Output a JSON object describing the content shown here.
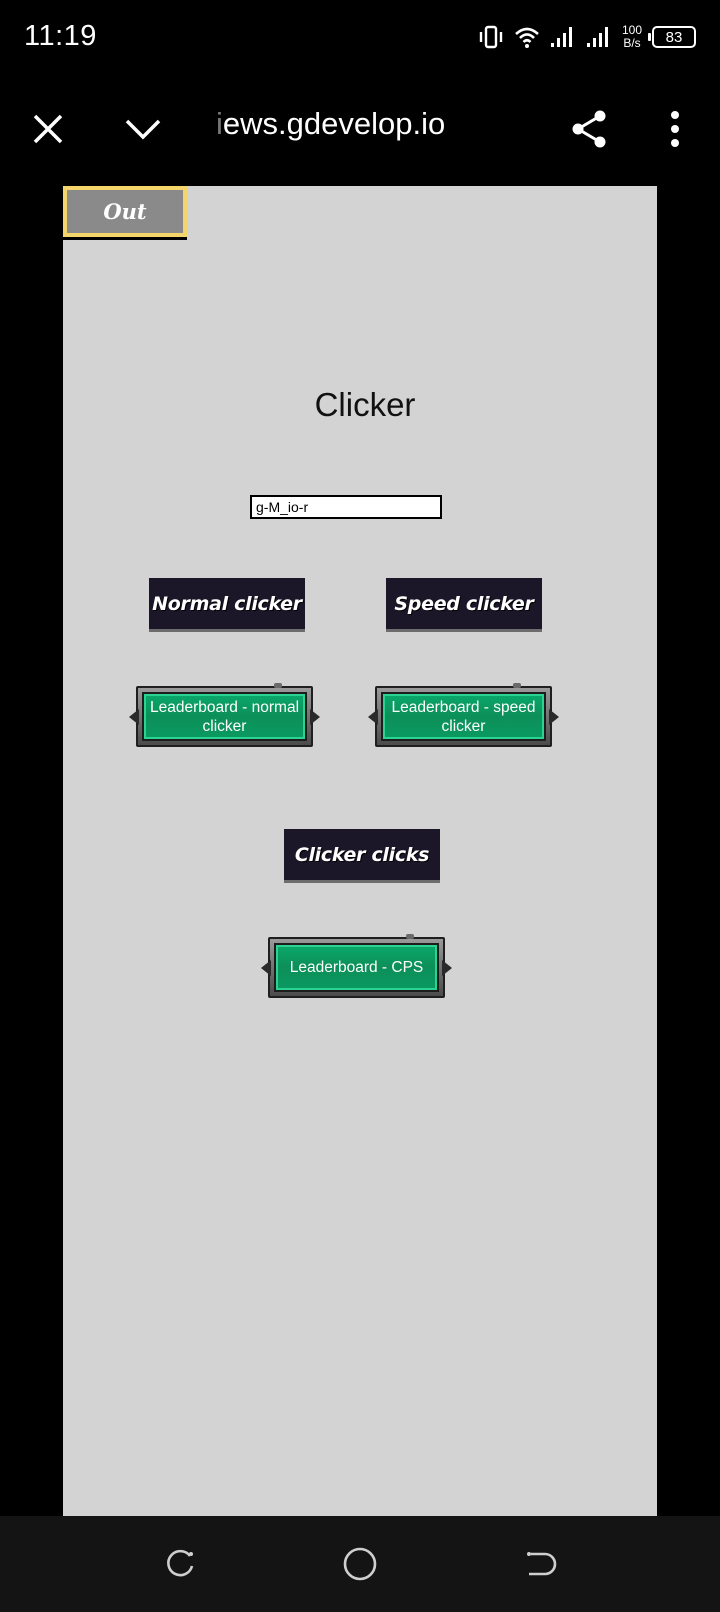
{
  "status_bar": {
    "time": "11:19",
    "net_speed_value": "100",
    "net_speed_unit": "B/s",
    "battery": "83",
    "icons": [
      "vibrate-icon",
      "wifi-icon",
      "signal-icon",
      "signal-icon",
      "battery-icon"
    ]
  },
  "browser": {
    "url_faded": "i",
    "url": "ews.gdevelop.io",
    "icons": [
      "close-icon",
      "chevron-down-icon",
      "share-icon",
      "more-vert-icon"
    ]
  },
  "game": {
    "out_label": "Out",
    "title": "Clicker",
    "name_input_value": "g-M_io-r",
    "buttons": {
      "normal_clicker": "Normal clicker",
      "speed_clicker": "Speed clicker",
      "clicker_clicks": "Clicker clicks"
    },
    "leaderboards": {
      "normal": "Leaderboard - normal clicker",
      "speed": "Leaderboard - speed clicker",
      "cps": "Leaderboard - CPS"
    },
    "colors": {
      "canvas_bg": "#d3d3d3",
      "dark_button": "#1b1628",
      "green_button": "#0c8f58",
      "out_border": "#f3d56b"
    }
  },
  "navbar": {
    "icons": [
      "recents-icon",
      "home-icon",
      "back-icon"
    ]
  }
}
